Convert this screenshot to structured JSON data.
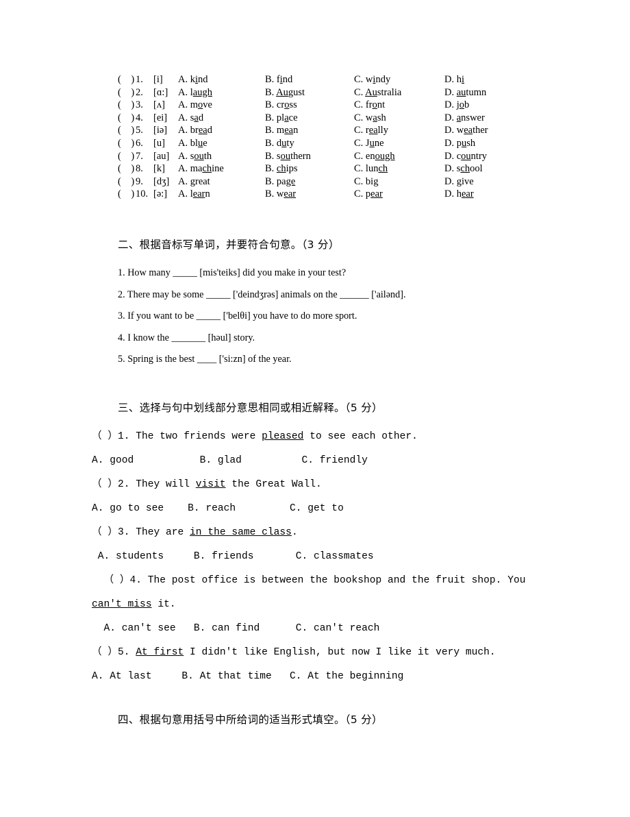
{
  "document": {
    "type": "english-exam-worksheet",
    "background_color": "#ffffff",
    "text_color": "#000000"
  },
  "part_one": {
    "columns": [
      "A",
      "B",
      "C",
      "D"
    ],
    "rows": [
      {
        "number": "1.",
        "symbol": "[i]",
        "a": "kind",
        "a_u": "i",
        "b": "find",
        "b_u": "i",
        "c": "windy",
        "c_u": "i",
        "d": "hi",
        "d_u": "i"
      },
      {
        "number": "2.",
        "symbol": "[ɑ:]",
        "a": "laugh",
        "a_u": "augh",
        "b": "August",
        "b_u": "Au",
        "c": "Australia",
        "c_u": "Au",
        "d": "autumn",
        "d_u": "au"
      },
      {
        "number": "3.",
        "symbol": "[ʌ]",
        "a": "move",
        "a_u": "o",
        "b": "cross",
        "b_u": "o",
        "c": "front",
        "c_u": "o",
        "d": "job",
        "d_u": "o"
      },
      {
        "number": "4.",
        "symbol": "[ei]",
        "a": "sad",
        "a_u": "a",
        "b": "place",
        "b_u": "a",
        "c": "wash",
        "c_u": "a",
        "d": "answer",
        "d_u": "a"
      },
      {
        "number": "5.",
        "symbol": "[iə]",
        "a": "bread",
        "a_u": "ea",
        "b": "mean",
        "b_u": "ea",
        "c": "really",
        "c_u": "ea",
        "d": "weather",
        "d_u": "ea"
      },
      {
        "number": "6.",
        "symbol": "[u]",
        "a": "blue",
        "a_u": "u",
        "b": "duty",
        "b_u": "u",
        "c": "June",
        "c_u": "u",
        "d": "push",
        "d_u": "u"
      },
      {
        "number": "7.",
        "symbol": "[au]",
        "a": "south",
        "a_u": "ou",
        "b": "southern",
        "b_u": "ou",
        "c": "enough",
        "c_u": "ough",
        "d": "country",
        "d_u": "ou"
      },
      {
        "number": "8.",
        "symbol": "[k]",
        "a": "machine",
        "a_u": "ch",
        "b": "chips",
        "b_u": "ch",
        "c": "lunch",
        "c_u": "ch",
        "d": "school",
        "d_u": "ch"
      },
      {
        "number": "9.",
        "symbol": "[dʒ]",
        "a": "great",
        "a_u": "g",
        "b": "page",
        "b_u": "ge",
        "c": "big",
        "c_u": "g",
        "d": "give",
        "d_u": "g"
      },
      {
        "number": "10.",
        "symbol": "[ə:]",
        "a": "learn",
        "a_u": "ear",
        "b": "wear",
        "b_u": "ear",
        "c": "pear",
        "c_u": "ear",
        "d": "hear",
        "d_u": "ear"
      }
    ],
    "paren": "(",
    "paren_close": ")",
    "label_a": "A.",
    "label_b": "B.",
    "label_c": "C.",
    "label_d": "D."
  },
  "part_two": {
    "heading": "二、根据音标写单词，并要符合句意。（3 分）",
    "questions": [
      "1. How many _____ [mis'teiks] did you make in your test?",
      "2. There may be some _____ ['deindʒrəs] animals on the ______ ['ailənd].",
      "3. If you want to be _____ ['belθi] you have to do more sport.",
      "4. I know the _______ [həul] story.",
      "5. Spring is the best ____ ['si:zn] of the year."
    ]
  },
  "part_three": {
    "heading": "三、选择与句中划线部分意思相同或相近解释。（5 分）",
    "items": [
      {
        "stem_before": "（ ）1. The two friends were ",
        "stem_underlined": "pleased",
        "stem_after": " to see each other.",
        "options": "A. good           B. glad          C. friendly"
      },
      {
        "stem_before": "（ ）2. They will ",
        "stem_underlined": "visit",
        "stem_after": " the Great Wall.",
        "options": "A. go to see    B. reach         C. get to"
      },
      {
        "stem_before": "（ ）3. They are ",
        "stem_underlined": "in the same class",
        "stem_after": ".",
        "options": " A. students     B. friends       C. classmates"
      },
      {
        "stem_before": "  （ ）4. The post office is between the bookshop and the fruit shop. You\n",
        "stem_underlined": "can't miss",
        "stem_after": " it.",
        "options": "  A. can't see   B. can find      C. can't reach"
      },
      {
        "stem_before": "（ ）5. ",
        "stem_underlined": "At first",
        "stem_after": " I didn't like English, but now I like it very much.",
        "options": "A. At last     B. At that time   C. At the beginning"
      }
    ]
  },
  "part_four": {
    "heading": "四、根据句意用括号中所给词的适当形式填空。（5 分）"
  }
}
